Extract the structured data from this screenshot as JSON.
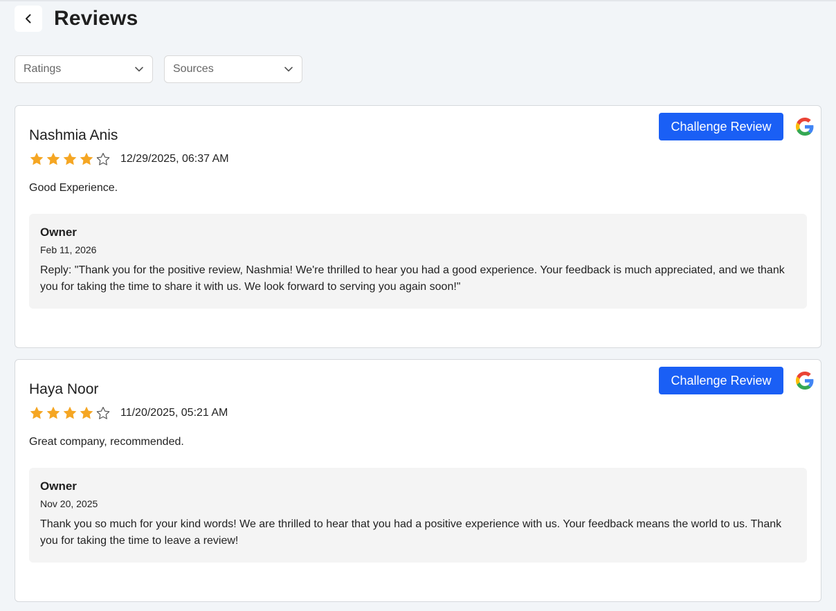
{
  "header": {
    "title": "Reviews",
    "back_icon": "chevron-left-icon"
  },
  "filters": {
    "ratings_placeholder": "Ratings",
    "sources_placeholder": "Sources"
  },
  "colors": {
    "accent": "#1a5ff5",
    "star_filled": "#f5a623",
    "reply_bg": "#f4f4f4"
  },
  "reviews": [
    {
      "name": "Nashmia Anis",
      "rating": 4,
      "max_rating": 5,
      "date": "12/29/2025, 06:37 AM",
      "text": "Good Experience.",
      "source_icon": "google-icon",
      "challenge_label": "Challenge Review",
      "reply": {
        "author": "Owner",
        "date": "Feb 11, 2026",
        "text": "Reply: \"Thank you for the positive review, Nashmia! We're thrilled to hear you had a good experience. Your feedback is much appreciated, and we thank you for taking the time to share it with us. We look forward to serving you again soon!\""
      }
    },
    {
      "name": "Haya Noor",
      "rating": 4,
      "max_rating": 5,
      "date": "11/20/2025, 05:21 AM",
      "text": "Great company, recommended.",
      "source_icon": "google-icon",
      "challenge_label": "Challenge Review",
      "reply": {
        "author": "Owner",
        "date": "Nov 20, 2025",
        "text": "Thank you so much for your kind words! We are thrilled to hear that you had a positive experience with us. Your feedback means the world to us. Thank you for taking the time to leave a review!"
      }
    }
  ]
}
